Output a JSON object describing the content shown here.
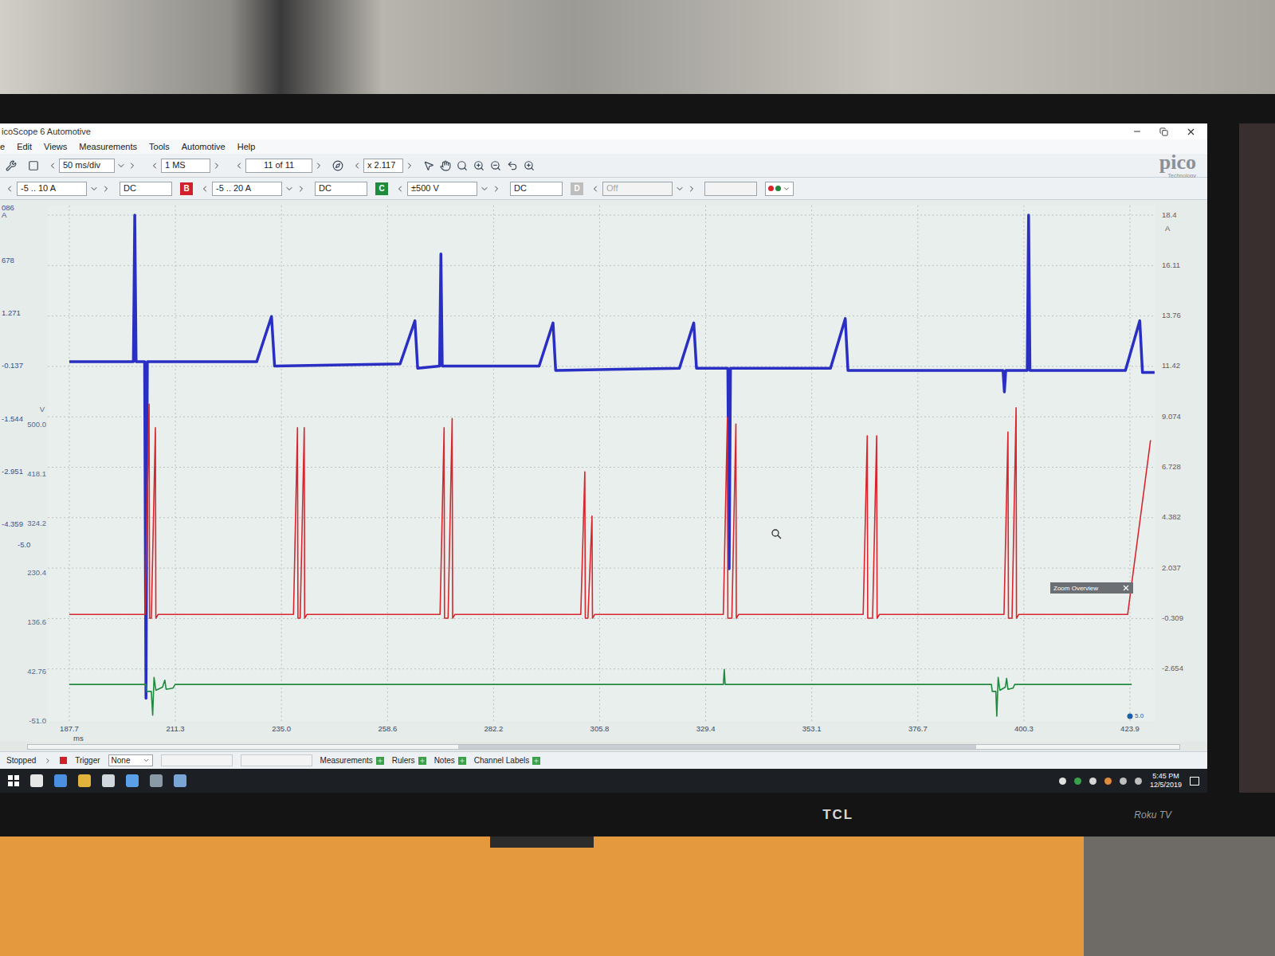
{
  "window": {
    "title": "icoScope 6 Automotive"
  },
  "menu": [
    {
      "label": "e"
    },
    {
      "label": "Edit"
    },
    {
      "label": "Views"
    },
    {
      "label": "Measurements"
    },
    {
      "label": "Tools"
    },
    {
      "label": "Automotive"
    },
    {
      "label": "Help"
    }
  ],
  "toolbar": {
    "timebase": "50 ms/div",
    "samples": "1 MS",
    "buffer": "11 of 11",
    "zoom": "x 2.117"
  },
  "logo": {
    "name": "pico",
    "tagline": "Technology"
  },
  "channels": [
    {
      "range": "-5 .. 10 A",
      "coupling": "DC",
      "enabled": true,
      "color": "#2b3bd0"
    },
    {
      "letter": "B",
      "range": "-5 .. 20 A",
      "coupling": "DC",
      "enabled": true,
      "color": "#d0202a"
    },
    {
      "letter": "C",
      "range": "±500 V",
      "coupling": "DC",
      "enabled": true,
      "color": "#1e8c3a"
    },
    {
      "letter": "D",
      "range": "Off",
      "enabled": false,
      "color": "#c9b800"
    }
  ],
  "chart": {
    "left_axes": [
      {
        "unit": "A",
        "ticks": [
          "086",
          "678",
          "1.271",
          "-0.137",
          "-1.544",
          "-2.951",
          "-4.359"
        ],
        "end_label": "-5.0"
      },
      {
        "unit": "V",
        "ticks": [
          "500.0",
          "418.1",
          "324.2",
          "230.4",
          "136.6",
          "42.76",
          "-51.0"
        ]
      }
    ],
    "right_axis": {
      "unit": "A",
      "ticks": [
        "18.4",
        "16.11",
        "13.76",
        "11.42",
        "9.074",
        "6.728",
        "4.382",
        "2.037",
        "-0.309",
        "-2.654"
      ]
    },
    "x_axis": {
      "unit": "ms",
      "ticks": [
        "187.7",
        "211.3",
        "235.0",
        "258.6",
        "282.2",
        "305.8",
        "329.4",
        "353.1",
        "376.7",
        "400.3",
        "423.9"
      ]
    },
    "series": [
      {
        "kind": "current",
        "color": "#2a2fc4",
        "t": [
          187.7,
          202.0,
          202.3,
          202.6,
          204.5,
          204.8,
          205.1,
          229.5,
          232.8,
          233.5,
          261.5,
          264.8,
          265.4,
          270.3,
          270.6,
          270.9,
          292.5,
          295.6,
          296.2,
          323.8,
          327.0,
          327.6,
          334.6,
          334.9,
          335.2,
          357.5,
          360.8,
          361.4,
          396.0,
          396.3,
          396.6,
          401.4,
          401.7,
          402.0,
          423.3,
          426.5,
          427.1,
          429.8
        ],
        "values": [
          11.6,
          11.6,
          18.4,
          11.6,
          11.6,
          -4.0,
          11.6,
          11.6,
          13.7,
          11.4,
          11.5,
          13.5,
          11.3,
          11.4,
          16.6,
          11.4,
          11.4,
          13.4,
          11.2,
          11.3,
          13.4,
          11.3,
          11.3,
          2.0,
          11.3,
          11.3,
          13.6,
          11.2,
          11.2,
          10.2,
          11.2,
          11.2,
          18.4,
          11.2,
          11.2,
          13.5,
          11.1,
          11.1
        ]
      },
      {
        "kind": "voltage",
        "color": "#d8262e",
        "t": [
          187.7,
          204.6,
          205.5,
          205.6,
          206.0,
          206.9,
          207.0,
          207.5,
          237.7,
          238.6,
          238.7,
          239.2,
          240.1,
          240.2,
          240.7,
          270.4,
          271.3,
          271.4,
          272.2,
          273.1,
          273.2,
          273.7,
          301.8,
          302.7,
          302.8,
          303.4,
          304.3,
          304.4,
          304.9,
          333.6,
          334.5,
          334.6,
          335.5,
          336.4,
          336.5,
          337.0,
          364.8,
          365.7,
          365.8,
          366.9,
          367.8,
          367.9,
          368.4,
          396.2,
          397.1,
          397.2,
          398.0,
          398.9,
          399.0,
          399.5,
          423.8,
          428.9
        ],
        "values": [
          147,
          147,
          538,
          140,
          140,
          494,
          140,
          147,
          147,
          494,
          140,
          140,
          494,
          140,
          147,
          147,
          494,
          140,
          140,
          511,
          140,
          147,
          147,
          412,
          140,
          140,
          330,
          140,
          147,
          147,
          513,
          140,
          140,
          501,
          140,
          147,
          147,
          479,
          140,
          140,
          479,
          140,
          147,
          147,
          486,
          140,
          140,
          531,
          140,
          147,
          147,
          471
        ]
      },
      {
        "kind": "voltage",
        "color": "#1f8a3e",
        "t": [
          187.7,
          204.8,
          205.0,
          206.0,
          206.3,
          206.6,
          207.0,
          208.5,
          209.0,
          209.3,
          210.8,
          211.3,
          333.6,
          333.8,
          334.0,
          393.4,
          393.6,
          394.4,
          394.6,
          394.9,
          395.3,
          396.5,
          396.8,
          397.1,
          398.2,
          398.6,
          424.7
        ],
        "values": [
          17,
          17,
          4,
          4,
          -40,
          30,
          6,
          12,
          25,
          8,
          10,
          17,
          17,
          45,
          17,
          17,
          4,
          4,
          -42,
          30,
          6,
          12,
          28,
          8,
          10,
          17,
          17
        ]
      }
    ],
    "overlay": {
      "label": "Zoom Overview"
    },
    "marker": {
      "label": "5.0"
    }
  },
  "status_bar": {
    "state": "Stopped",
    "trigger_label": "Trigger",
    "trigger_mode": "None",
    "items": [
      {
        "label": "Measurements"
      },
      {
        "label": "Rulers"
      },
      {
        "label": "Notes"
      },
      {
        "label": "Channel Labels"
      }
    ]
  },
  "taskbar": {
    "time": "5:45 PM",
    "date": "12/5/2019"
  },
  "monitor": {
    "brand": "TCL",
    "badge": "Roku TV"
  }
}
